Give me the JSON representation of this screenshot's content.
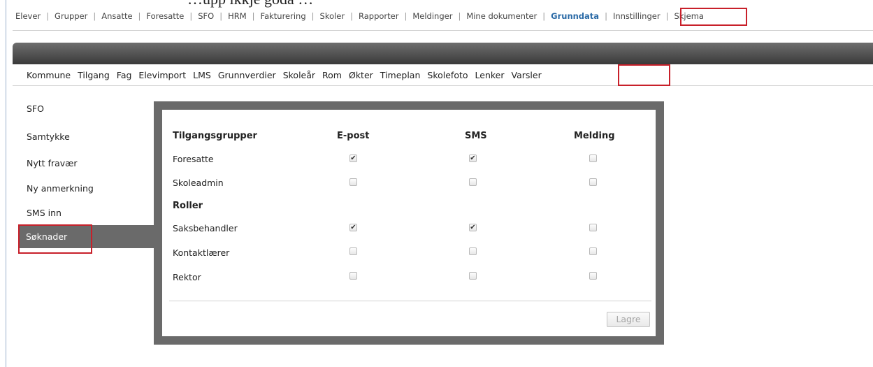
{
  "document": {
    "caption": "…upp ikkje goda …"
  },
  "top_nav": {
    "items": [
      "Elever",
      "Grupper",
      "Ansatte",
      "Foresatte",
      "SFO",
      "HRM",
      "Fakturering",
      "Skoler",
      "Rapporter",
      "Meldinger",
      "Mine dokumenter",
      "Grunndata",
      "Innstillinger",
      "Skjema"
    ],
    "active": "Grunndata"
  },
  "sub_nav": {
    "tabs": [
      "Kommune",
      "Tilgang",
      "Fag",
      "Elevimport",
      "LMS",
      "Grunnverdier",
      "Skoleår",
      "Rom",
      "Økter",
      "Timeplan",
      "Skolefoto",
      "Lenker",
      "Varsler"
    ],
    "active": "Varsler"
  },
  "side_menu": {
    "items": [
      "SFO",
      "Samtykke",
      "Nytt fravær",
      "Ny anmerkning",
      "SMS inn",
      "Søknader"
    ],
    "selected": "Søknader"
  },
  "panel": {
    "header_groups": "Tilgangsgrupper",
    "col_email": "E-post",
    "col_sms": "SMS",
    "col_message": "Melding",
    "groups": [
      {
        "label": "Foresatte",
        "email": true,
        "sms": true,
        "message": false
      },
      {
        "label": "Skoleadmin",
        "email": false,
        "sms": false,
        "message": false
      }
    ],
    "roles_header": "Roller",
    "roles": [
      {
        "label": "Saksbehandler",
        "email": true,
        "sms": true,
        "message": false
      },
      {
        "label": "Kontaktlærer",
        "email": false,
        "sms": false,
        "message": false
      },
      {
        "label": "Rektor",
        "email": false,
        "sms": false,
        "message": false
      }
    ],
    "save_label": "Lagre"
  },
  "colors": {
    "highlight": "#c8202a",
    "active_link": "#2a6aa6",
    "panel_frame": "#6a6a6a"
  }
}
